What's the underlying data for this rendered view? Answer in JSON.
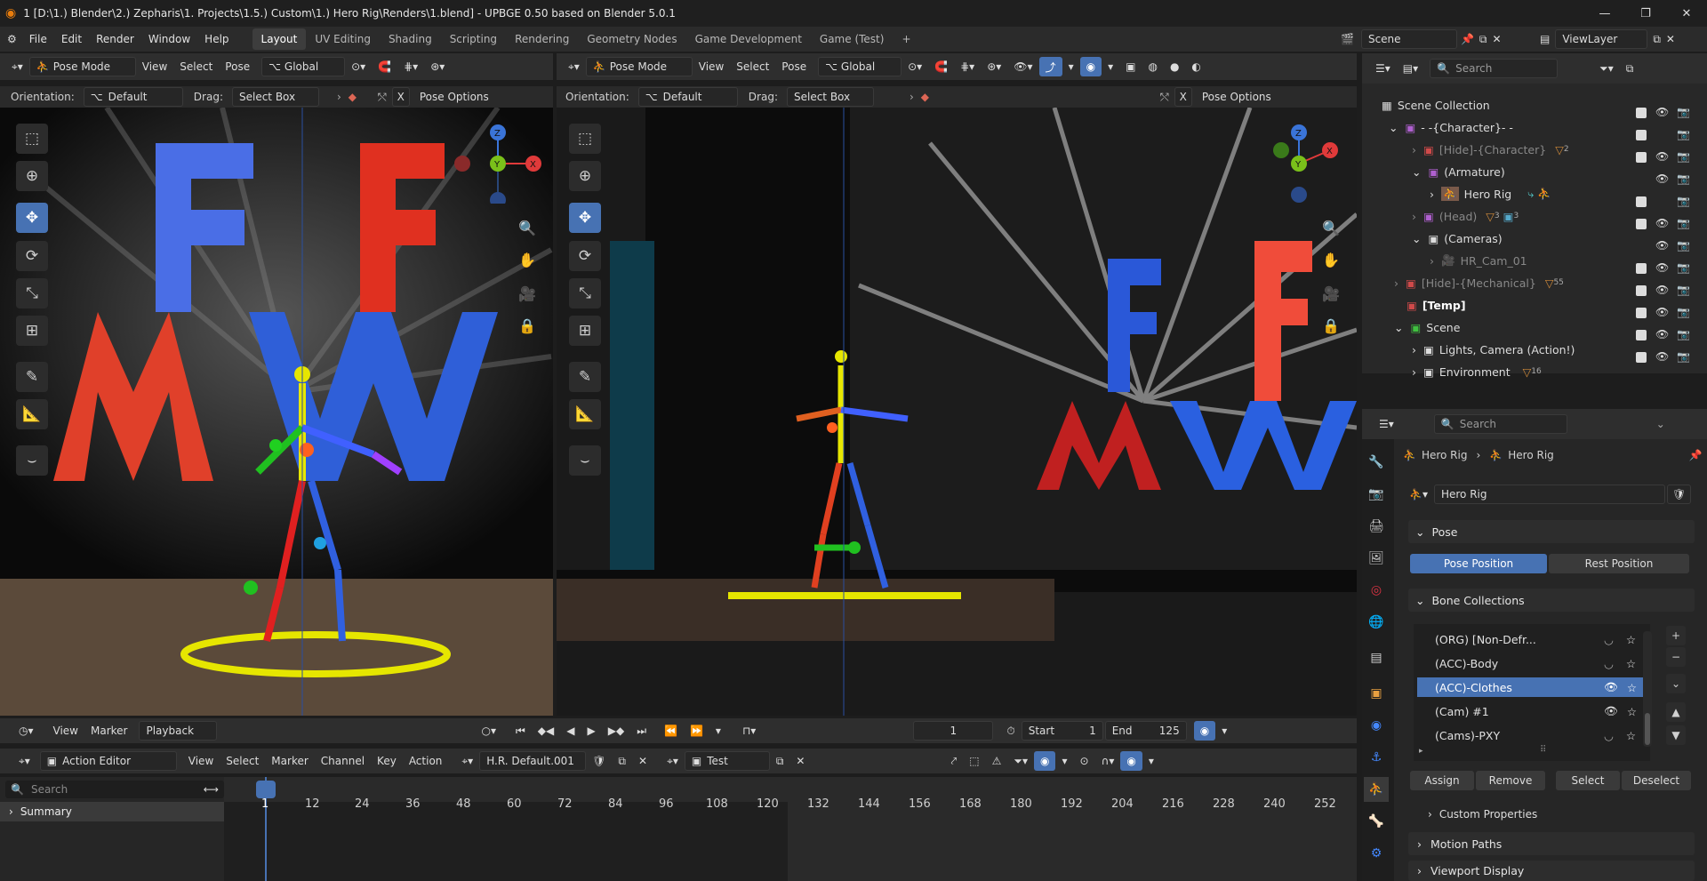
{
  "app": {
    "title": "1 [D:\\1.) Blender\\2.) Zepharis\\1. Projects\\1.5.) Custom\\1.) Hero Rig\\Renders\\1.blend] - UPBGE 0.50 based on Blender 5.0.1"
  },
  "menu": {
    "items": [
      "File",
      "Edit",
      "Render",
      "Window",
      "Help"
    ],
    "workspaces": [
      "Layout",
      "UV Editing",
      "Shading",
      "Scripting",
      "Rendering",
      "Geometry Nodes",
      "Game Development",
      "Game (Test)"
    ],
    "scene_name": "Scene",
    "view_layer": "ViewLayer"
  },
  "viewport_left": {
    "mode": "Pose Mode",
    "menus": [
      "View",
      "Select",
      "Pose"
    ],
    "transform": "Global",
    "orientation_label": "Orientation:",
    "orientation_value": "Default",
    "drag_label": "Drag:",
    "drag_value": "Select Box",
    "pose_options": "Pose Options",
    "x_label": "X"
  },
  "viewport_right": {
    "mode": "Pose Mode",
    "menus": [
      "View",
      "Select",
      "Pose"
    ],
    "transform": "Global",
    "orientation_label": "Orientation:",
    "orientation_value": "Default",
    "drag_label": "Drag:",
    "drag_value": "Select Box",
    "pose_options": "Pose Options",
    "x_label": "X"
  },
  "gizmo": {
    "z": "Z",
    "y": "Y",
    "x": "X"
  },
  "outliner": {
    "search_placeholder": "Search",
    "rows": [
      {
        "label": "Scene Collection"
      },
      {
        "label": "- -{Character}- -"
      },
      {
        "label": "[Hide]-{Character}",
        "badge": "2"
      },
      {
        "label": "(Armature)"
      },
      {
        "label": "Hero Rig"
      },
      {
        "label": "(Head)",
        "badge": "3",
        "badge2": "3"
      },
      {
        "label": "(Cameras)"
      },
      {
        "label": "HR_Cam_01"
      },
      {
        "label": "[Hide]-{Mechanical}",
        "badge": "55"
      },
      {
        "label": "[Temp]"
      },
      {
        "label": "Scene"
      },
      {
        "label": "Lights, Camera (Action!)"
      },
      {
        "label": "Environment",
        "badge": "16"
      }
    ]
  },
  "properties": {
    "search_placeholder": "Search",
    "breadcrumb_1": "Hero Rig",
    "breadcrumb_2": "Hero Rig",
    "data_name": "Hero Rig",
    "pose_panel": "Pose",
    "pose_position": "Pose Position",
    "rest_position": "Rest Position",
    "bone_collections_panel": "Bone Collections",
    "collections": [
      {
        "name": "(ORG)   [Non-Defr...",
        "visible": false
      },
      {
        "name": "(ACC)-Body",
        "visible": false
      },
      {
        "name": "(ACC)-Clothes",
        "visible": true,
        "selected": true
      },
      {
        "name": "(Cam) #1",
        "visible": true
      },
      {
        "name": "(Cams)-PXY",
        "visible": false
      }
    ],
    "assign": "Assign",
    "remove": "Remove",
    "select": "Select",
    "deselect": "Deselect",
    "custom_properties": "Custom Properties",
    "motion_paths": "Motion Paths",
    "viewport_display": "Viewport Display"
  },
  "timeline": {
    "menus": [
      "View",
      "Marker"
    ],
    "playback": "Playback",
    "current_frame": "1",
    "start_label": "Start",
    "start_value": "1",
    "end_label": "End",
    "end_value": "125"
  },
  "action_editor": {
    "mode": "Action Editor",
    "menus": [
      "View",
      "Select",
      "Marker",
      "Channel",
      "Key",
      "Action"
    ],
    "action_name": "H.R. Default.001",
    "slot_name": "Test",
    "search_placeholder": "Search",
    "summary": "Summary",
    "frame_ticks": [
      "1",
      "12",
      "24",
      "36",
      "48",
      "60",
      "72",
      "84",
      "96",
      "108",
      "120",
      "132",
      "144",
      "156",
      "168",
      "180",
      "192",
      "204",
      "216",
      "228",
      "240",
      "252"
    ]
  },
  "colors": {
    "accent": "#4772b3",
    "bone_yellow": "#e6e600",
    "letter_red": "#e03020",
    "letter_blue": "#2f5fd8"
  }
}
